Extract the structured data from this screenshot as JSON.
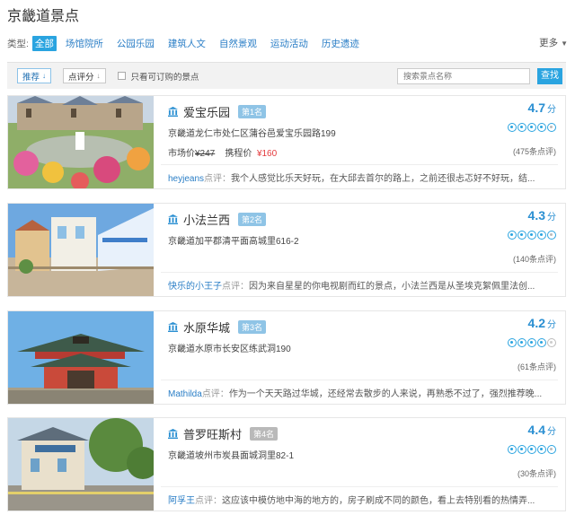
{
  "page": {
    "title": "京畿道景点"
  },
  "type_filter": {
    "label": "类型:",
    "categories": [
      "全部",
      "场馆院所",
      "公园乐园",
      "建筑人文",
      "自然景观",
      "运动活动",
      "历史遗迹"
    ],
    "active_index": 0,
    "more_label": "更多"
  },
  "toolbar": {
    "sort_recommend": "推荐",
    "sort_rating": "点评分",
    "bookable_only": "只看可订购的景点",
    "search_placeholder": "搜索景点名称",
    "search_button": "查找",
    "icon_sort_down": "arrow-down-icon",
    "icon_bank": "landmark-icon"
  },
  "colors": {
    "accent": "#2aa4e0",
    "link": "#2a7ec6",
    "sale": "#e4393c",
    "rank": "#8fc4e6"
  },
  "review_tag": "点评：",
  "attractions": [
    {
      "name": "爱宝乐园",
      "rank": "第1名",
      "address": "京畿道龙仁市处仁区蒲谷邑爱宝乐园路199",
      "score": "4.7",
      "score_unit": "分",
      "stars": 4.5,
      "review_count": "(475条点评)",
      "price_label": "市场价",
      "price_original": "¥247",
      "price_deal_label": "携程价",
      "price_deal": "¥160",
      "reviewer": "heyjeans",
      "comment": "我个人感觉比乐天好玩，在大邱去首尔的路上，之前还很忐忑好不好玩，结..."
    },
    {
      "name": "小法兰西",
      "rank": "第2名",
      "address": "京畿道加平郡清平面高城里616-2",
      "score": "4.3",
      "score_unit": "分",
      "stars": 4.5,
      "review_count": "(140条点评)",
      "reviewer": "快乐的小王子",
      "comment": "因为来自星星的你电视剧而红的景点，小法兰西是从圣埃克絮佩里法创..."
    },
    {
      "name": "水原华城",
      "rank": "第3名",
      "address": "京畿道水原市长安区练武洞190",
      "score": "4.2",
      "score_unit": "分",
      "stars": 4,
      "review_count": "(61条点评)",
      "reviewer": "Mathilda",
      "comment": "作为一个天天路过华城，还经常去散步的人来说，再熟悉不过了，强烈推荐晚..."
    },
    {
      "name": "普罗旺斯村",
      "rank": "第4名",
      "address": "京畿道坡州市炭县面城洞里82-1",
      "score": "4.4",
      "score_unit": "分",
      "stars": 4.5,
      "review_count": "(30条点评)",
      "reviewer": "阿孚王",
      "comment": "这应该中模仿地中海的地方的，房子刷成不同的颜色，看上去特别看的热情弄..."
    }
  ],
  "photo_caption_2": "CTRIP 王子同"
}
